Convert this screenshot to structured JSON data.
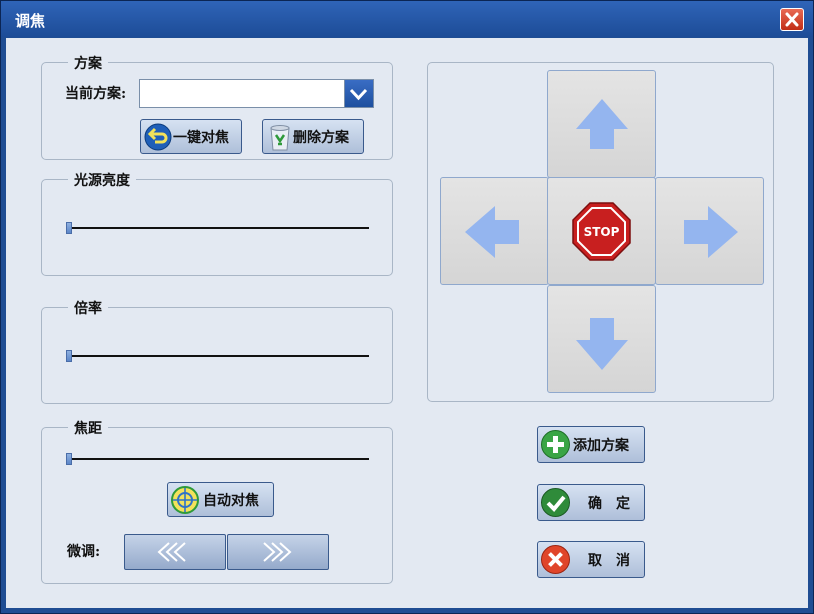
{
  "window": {
    "title": "调焦"
  },
  "scheme": {
    "group_label": "方案",
    "current_label": "当前方案:",
    "current_value": "",
    "one_key_focus": "一键对焦",
    "delete_scheme": "删除方案"
  },
  "light": {
    "group_label": "光源亮度",
    "value": 0
  },
  "magnification": {
    "group_label": "倍率",
    "value": 0
  },
  "focal": {
    "group_label": "焦距",
    "value": 0,
    "auto_focus": "自动对焦",
    "fine_label": "微调:"
  },
  "stop_text": "STOP",
  "actions": {
    "add_scheme": "添加方案",
    "confirm": "确　定",
    "cancel": "取　消"
  },
  "icons": {
    "close": "close-icon",
    "dropdown": "chevron-down-icon",
    "one_key": "return-arrow-icon",
    "delete": "recycle-bin-icon",
    "auto_focus": "target-icon",
    "add": "plus-icon",
    "confirm": "checkmark-icon",
    "cancel": "x-icon",
    "stop": "stop-sign-icon"
  }
}
